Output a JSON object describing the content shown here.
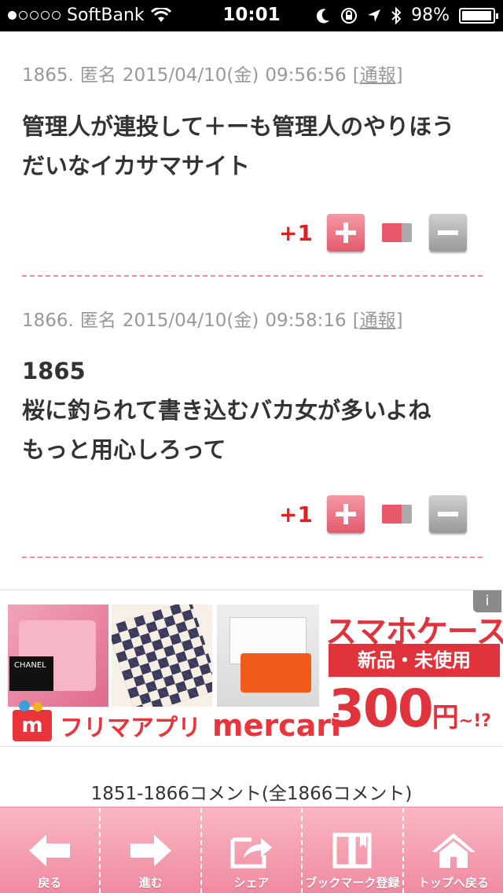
{
  "status_bar": {
    "carrier": "SoftBank",
    "time": "10:01",
    "battery": "98%",
    "battery_level": 0.98,
    "signal_bars_filled": 1,
    "signal_bars_total": 5
  },
  "comments": [
    {
      "number": "1865.",
      "author": "匿名",
      "date": "2015/04/10(金)",
      "time": "09:56:56",
      "report_label": "[通報]",
      "body": "管理人が連投して＋ーも管理人のやりほう\nだいなイカサマサイト",
      "score": "+1",
      "ratio_good": 0.65
    },
    {
      "number": "1866.",
      "author": "匿名",
      "date": "2015/04/10(金)",
      "time": "09:58:16",
      "report_label": "[通報]",
      "body": "1865\n桜に釣られて書き込むバカ女が多いよね\nもっと用心しろって",
      "score": "+1",
      "ratio_good": 0.65
    }
  ],
  "ad": {
    "info_icon": "i",
    "headline": "スマホケース",
    "tag": "新品・未使用",
    "price": "300",
    "price_unit": "円",
    "price_tail": "~!?",
    "logo_letter": "m",
    "logo_jp": "フリマアプリ",
    "logo_en": "mercari",
    "card_text": "CHANEL"
  },
  "pager": {
    "text": "1851-1866コメント(全1866コメント)"
  },
  "bottom_nav": [
    {
      "label": "戻る",
      "icon": "back-arrow-icon"
    },
    {
      "label": "進む",
      "icon": "forward-arrow-icon"
    },
    {
      "label": "シェア",
      "icon": "share-icon"
    },
    {
      "label": "ブックマーク登録",
      "icon": "bookmark-book-icon"
    },
    {
      "label": "トップへ戻る",
      "icon": "home-icon"
    }
  ],
  "colors": {
    "accent_pink": "#f08aa0",
    "score_red": "#dd2222",
    "ad_red": "#e0333b"
  }
}
